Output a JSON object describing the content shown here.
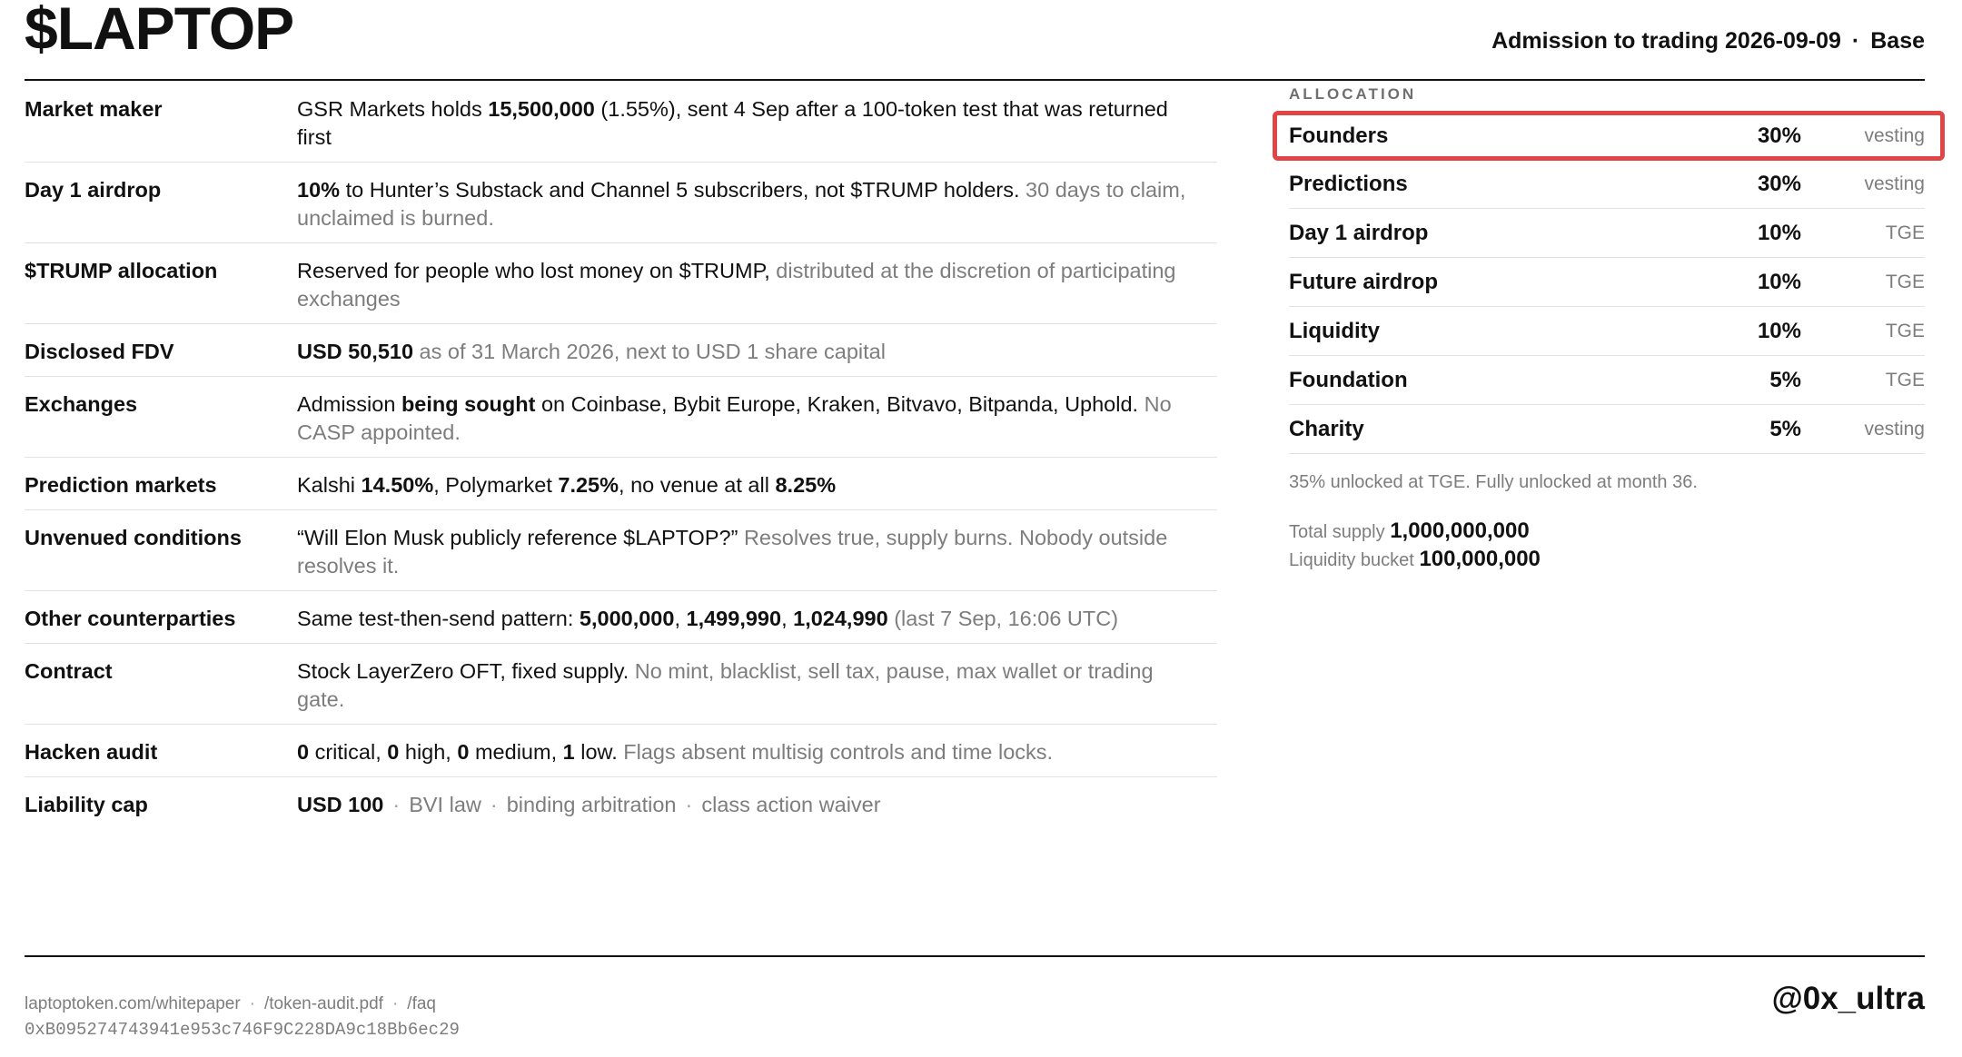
{
  "header": {
    "title": "$LAPTOP",
    "admission": "Admission to trading 2026-09-09",
    "separator": "·",
    "network": "Base"
  },
  "facts": {
    "market_maker": {
      "label": "Market maker",
      "t1": "GSR Markets holds ",
      "b1": "15,500,000",
      "t2": " (1.55%), sent 4 Sep after a 100-token test that was returned first"
    },
    "day1_airdrop": {
      "label": "Day 1 airdrop",
      "b1": "10%",
      "t1": " to Hunter’s Substack and Channel 5 subscribers, not $TRUMP holders. ",
      "m1": "30 days to claim, unclaimed is burned."
    },
    "trump_allocation": {
      "label": "$TRUMP allocation",
      "t1": "Reserved for people who lost money on $TRUMP, ",
      "m1": "distributed at the discretion of participating exchanges"
    },
    "disclosed_fdv": {
      "label": "Disclosed FDV",
      "b1": "USD 50,510",
      "m1": " as of 31 March 2026, next to USD 1 share capital"
    },
    "exchanges": {
      "label": "Exchanges",
      "t1": "Admission ",
      "b1": "being sought",
      "t2": " on Coinbase, Bybit Europe, Kraken, Bitvavo, Bitpanda, Uphold. ",
      "m1": "No CASP appointed."
    },
    "prediction_markets": {
      "label": "Prediction markets",
      "t1": "Kalshi ",
      "b1": "14.50%",
      "t2": ", Polymarket ",
      "b2": "7.25%",
      "t3": ", no venue at all ",
      "b3": "8.25%"
    },
    "unvenued_conditions": {
      "label": "Unvenued conditions",
      "t1": "“Will Elon Musk publicly reference $LAPTOP?” ",
      "m1": "Resolves true, supply burns. Nobody outside resolves it."
    },
    "other_counterparties": {
      "label": "Other counterparties",
      "t1": "Same test-then-send pattern: ",
      "b1": "5,000,000",
      "c1": ", ",
      "b2": "1,499,990",
      "c2": ", ",
      "b3": "1,024,990",
      "m1": " (last 7 Sep, 16:06 UTC)"
    },
    "contract": {
      "label": "Contract",
      "t1": "Stock LayerZero OFT, fixed supply. ",
      "m1": "No mint, blacklist, sell tax, pause, max wallet or trading gate."
    },
    "hacken_audit": {
      "label": "Hacken audit",
      "b1": "0",
      "t1": " critical, ",
      "b2": "0",
      "t2": " high, ",
      "b3": "0",
      "t3": " medium, ",
      "b4": "1",
      "t4": " low. ",
      "m1": "Flags absent multisig controls and time locks."
    },
    "liability_cap": {
      "label": "Liability cap",
      "b1": "USD 100",
      "separator": "·",
      "m1": "BVI law",
      "m2": "binding arbitration",
      "m3": "class action waiver"
    }
  },
  "allocation": {
    "heading": "ALLOCATION",
    "rows": [
      {
        "name": "Founders",
        "pct": "30%",
        "tag": "vesting"
      },
      {
        "name": "Predictions",
        "pct": "30%",
        "tag": "vesting"
      },
      {
        "name": "Day 1 airdrop",
        "pct": "10%",
        "tag": "TGE"
      },
      {
        "name": "Future airdrop",
        "pct": "10%",
        "tag": "TGE"
      },
      {
        "name": "Liquidity",
        "pct": "10%",
        "tag": "TGE"
      },
      {
        "name": "Foundation",
        "pct": "5%",
        "tag": "TGE"
      },
      {
        "name": "Charity",
        "pct": "5%",
        "tag": "vesting"
      }
    ],
    "unlock_note": "35% unlocked at TGE. Fully unlocked at month 36.",
    "total_supply_label": "Total supply",
    "total_supply_value": "1,000,000,000",
    "liquidity_bucket_label": "Liquidity bucket",
    "liquidity_bucket_value": "100,000,000",
    "highlight_color": "#e04646"
  },
  "footer": {
    "link_whitepaper": "laptoptoken.com/whitepaper",
    "link_audit": "/token-audit.pdf",
    "link_faq": "/faq",
    "separator": "·",
    "contract_address": "0xB095274743941e953c746F9C228DA9c18Bb6ec29",
    "handle": "@0x_ultra"
  }
}
